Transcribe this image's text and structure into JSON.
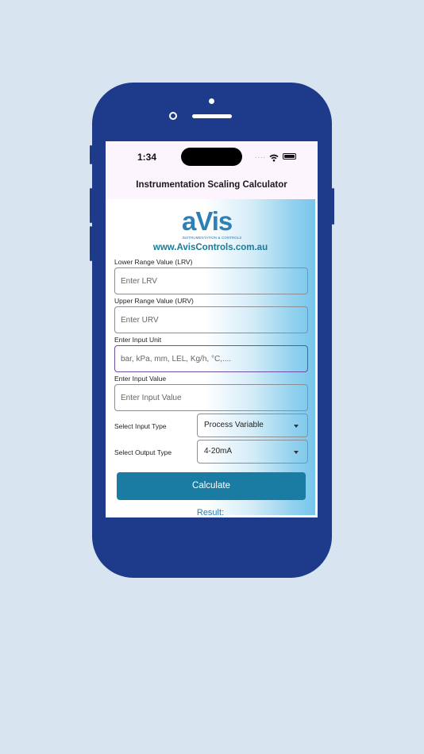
{
  "status_bar": {
    "time": "1:34",
    "signal_dots": "....",
    "wifi_icon": "wifi-icon",
    "battery_icon": "battery-icon"
  },
  "app_bar": {
    "title": "Instrumentation Scaling Calculator"
  },
  "logo": {
    "text": "aVis",
    "tagline": "INSTRUMENTATION & CONTROLS"
  },
  "website": "www.AvisControls.com.au",
  "form": {
    "lrv": {
      "label": "Lower Range Value (LRV)",
      "placeholder": "Enter LRV",
      "value": ""
    },
    "urv": {
      "label": "Upper Range Value (URV)",
      "placeholder": "Enter URV",
      "value": ""
    },
    "unit": {
      "label": "Enter Input Unit",
      "placeholder": "bar, kPa, mm, LEL, Kg/h, °C,....",
      "value": ""
    },
    "input_value": {
      "label": "Enter Input Value",
      "placeholder": "Enter Input Value",
      "value": ""
    },
    "input_type": {
      "label": "Select Input Type",
      "selected": "Process Variable"
    },
    "output_type": {
      "label": "Select Output Type",
      "selected": "4-20mA"
    },
    "calculate_label": "Calculate",
    "result_label": "Result:"
  },
  "colors": {
    "phone_frame": "#1e3a8a",
    "background": "#d9e4f1",
    "button": "#1a7ba3",
    "accent_text": "#1a7a98",
    "focus_border": "#6b4fa0"
  }
}
